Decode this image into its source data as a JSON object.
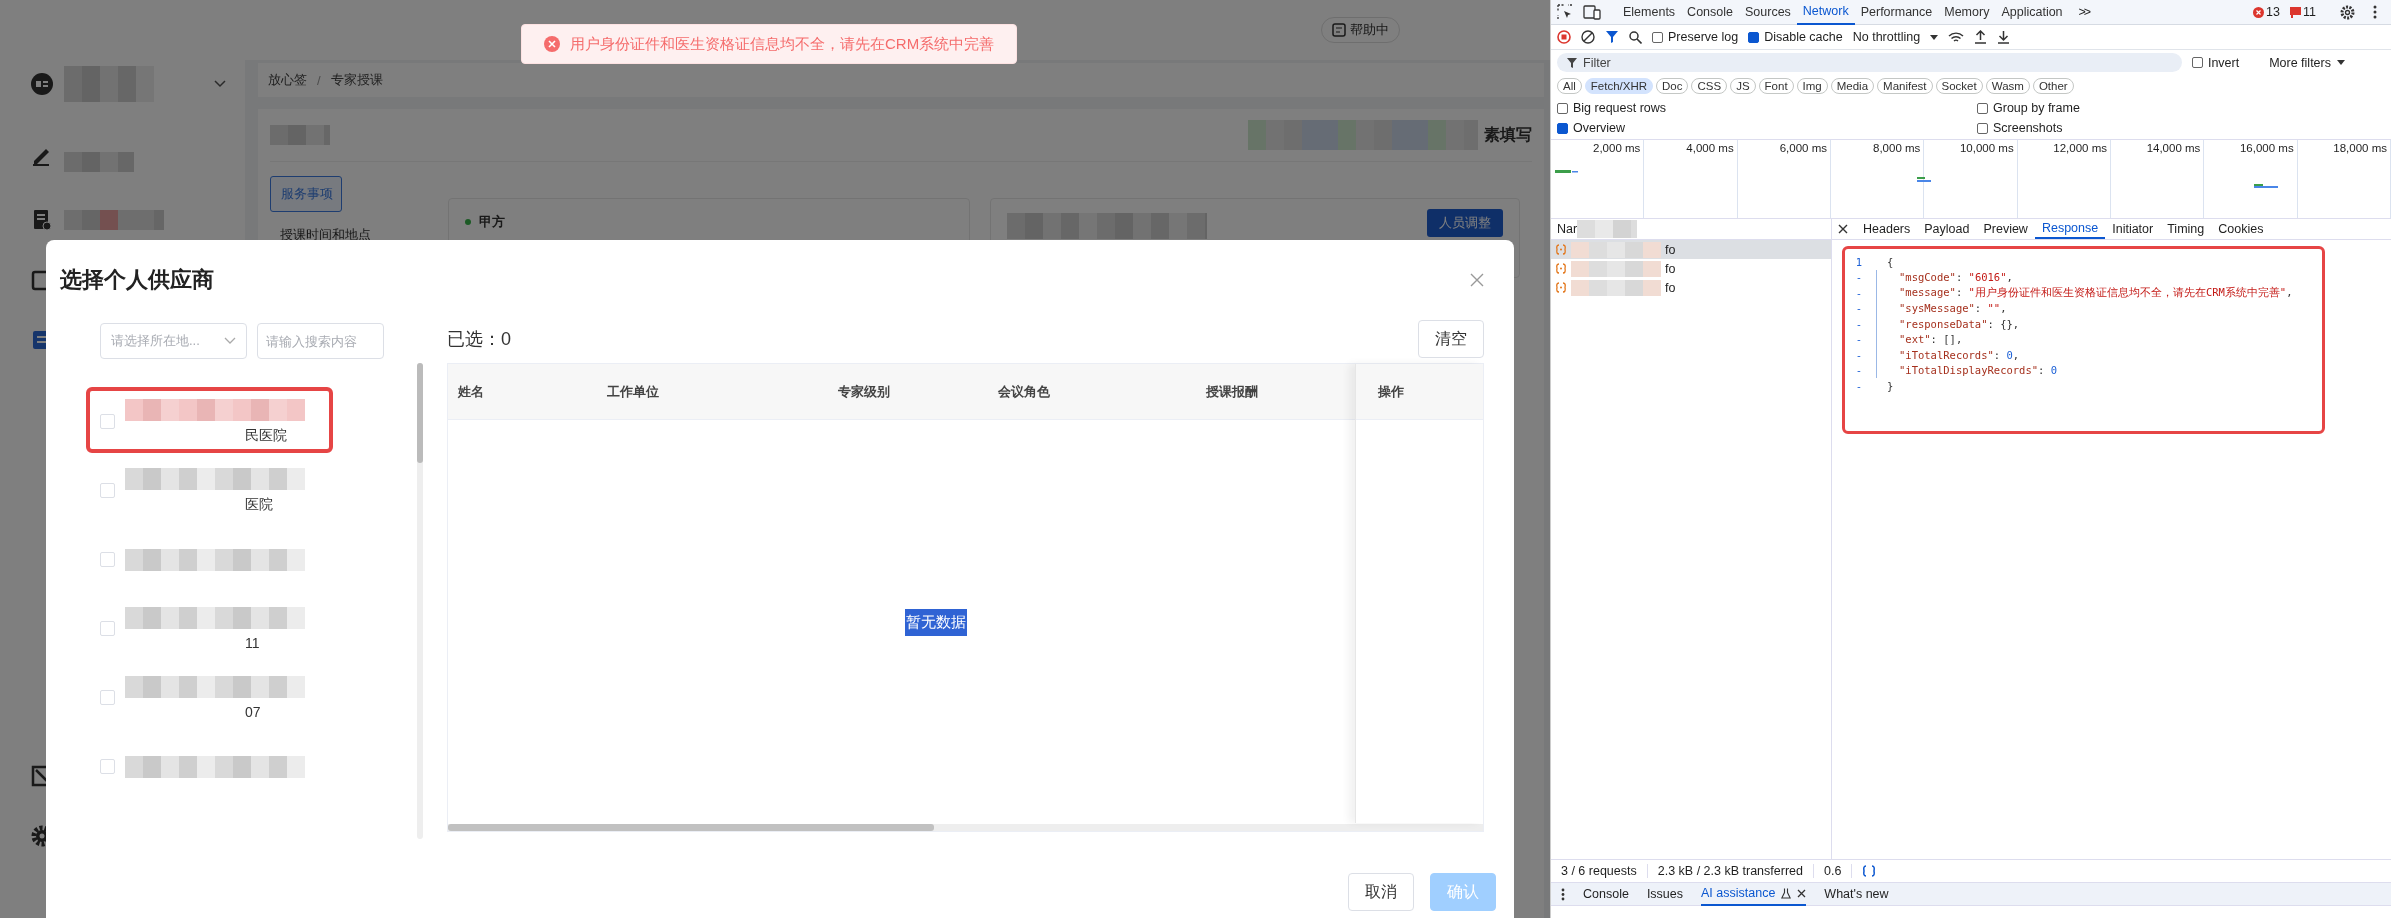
{
  "app": {
    "help_button": "帮助中",
    "breadcrumb": [
      {
        "label": "放心签"
      },
      {
        "label": "专家授课"
      }
    ],
    "breadcrumb_separator": "/",
    "section_title": "素填写",
    "service_tab": "服务事项",
    "side_item": "授课时间和地点",
    "party_a": "甲方",
    "adjust_button": "人员调整"
  },
  "toast": {
    "kind": "error",
    "message": "用户身份证件和医生资格证信息均不全，请先在CRM系统中完善"
  },
  "modal": {
    "title": "选择个人供应商",
    "region_select": {
      "placeholder": "请选择所在地..."
    },
    "search": {
      "placeholder": "请输入搜索内容"
    },
    "suppliers": [
      {
        "checked": false,
        "annotated": true,
        "text": "民医院"
      },
      {
        "checked": false,
        "annotated": false,
        "text": "医院"
      },
      {
        "checked": false,
        "annotated": false
      },
      {
        "checked": false,
        "annotated": false,
        "text": "11"
      },
      {
        "checked": false,
        "annotated": false,
        "text": "07"
      },
      {
        "checked": false,
        "annotated": false
      }
    ],
    "selected_count": "已选：0",
    "clear_button": "清空",
    "table": {
      "columns": [
        "姓名",
        "工作单位",
        "专家级别",
        "会议角色",
        "授课报酬",
        "操作"
      ],
      "empty_text": "暂无数据"
    },
    "buttons": [
      {
        "label": "取消",
        "disabled": false
      },
      {
        "label": "确认",
        "disabled": true
      }
    ]
  },
  "devtools": {
    "panel_tabs": [
      {
        "label": "Elements",
        "selected": false
      },
      {
        "label": "Console",
        "selected": false
      },
      {
        "label": "Sources",
        "selected": false
      },
      {
        "label": "Network",
        "selected": true
      },
      {
        "label": "Performance",
        "selected": false
      },
      {
        "label": "Memory",
        "selected": false
      },
      {
        "label": "Application",
        "selected": false
      }
    ],
    "more_tabs": ">>",
    "error_count": "13",
    "issue_count": "11",
    "preserve_log": {
      "label": "Preserve log",
      "checked": false
    },
    "disable_cache": {
      "label": "Disable cache",
      "checked": true
    },
    "throttling": "No throttling",
    "filter": {
      "placeholder": "Filter"
    },
    "invert": {
      "label": "Invert",
      "checked": false
    },
    "more_filters": "More filters",
    "type_filters": [
      {
        "label": "All",
        "selected": false
      },
      {
        "label": "Fetch/XHR",
        "selected": true
      },
      {
        "label": "Doc",
        "selected": false
      },
      {
        "label": "CSS",
        "selected": false
      },
      {
        "label": "JS",
        "selected": false
      },
      {
        "label": "Font",
        "selected": false
      },
      {
        "label": "Img",
        "selected": false
      },
      {
        "label": "Media",
        "selected": false
      },
      {
        "label": "Manifest",
        "selected": false
      },
      {
        "label": "Socket",
        "selected": false
      },
      {
        "label": "Wasm",
        "selected": false
      },
      {
        "label": "Other",
        "selected": false
      }
    ],
    "options": [
      {
        "label": "Big request rows",
        "checked": false
      },
      {
        "label": "Group by frame",
        "checked": false
      },
      {
        "label": "Overview",
        "checked": true
      },
      {
        "label": "Screenshots",
        "checked": false
      }
    ],
    "timeline_ticks": [
      "2,000 ms",
      "4,000 ms",
      "6,000 ms",
      "8,000 ms",
      "10,000 ms",
      "12,000 ms",
      "14,000 ms",
      "16,000 ms",
      "18,000 ms"
    ],
    "name_header": "Nar",
    "requests": [
      {
        "name": "fo",
        "selected": true
      },
      {
        "name": "fo",
        "selected": false
      },
      {
        "name": "fo",
        "selected": false
      }
    ],
    "detail_tabs": [
      {
        "label": "Headers",
        "selected": false
      },
      {
        "label": "Payload",
        "selected": false
      },
      {
        "label": "Preview",
        "selected": false
      },
      {
        "label": "Response",
        "selected": true
      },
      {
        "label": "Initiator",
        "selected": false
      },
      {
        "label": "Timing",
        "selected": false
      },
      {
        "label": "Cookies",
        "selected": false
      }
    ],
    "response": {
      "annotated": true,
      "lines": [
        {
          "marker": "1",
          "tokens": [
            {
              "kind": "punct",
              "text": "{"
            }
          ]
        },
        {
          "marker": "-",
          "tokens": [
            {
              "kind": "key",
              "text": "\"msgCode\""
            },
            {
              "kind": "punct",
              "text": ": "
            },
            {
              "kind": "string",
              "text": "\"6016\""
            },
            {
              "kind": "punct",
              "text": ","
            }
          ]
        },
        {
          "marker": "-",
          "tokens": [
            {
              "kind": "key",
              "text": "\"message\""
            },
            {
              "kind": "punct",
              "text": ": "
            },
            {
              "kind": "string",
              "text": "\"用户身份证件和医生资格证信息均不全，请先在CRM系统中完善\""
            },
            {
              "kind": "punct",
              "text": ","
            }
          ]
        },
        {
          "marker": "-",
          "tokens": [
            {
              "kind": "key",
              "text": "\"sysMessage\""
            },
            {
              "kind": "punct",
              "text": ": "
            },
            {
              "kind": "string",
              "text": "\"\""
            },
            {
              "kind": "punct",
              "text": ","
            }
          ]
        },
        {
          "marker": "-",
          "tokens": [
            {
              "kind": "key",
              "text": "\"responseData\""
            },
            {
              "kind": "punct",
              "text": ": {},"
            }
          ]
        },
        {
          "marker": "-",
          "tokens": [
            {
              "kind": "key",
              "text": "\"ext\""
            },
            {
              "kind": "punct",
              "text": ": [],"
            }
          ]
        },
        {
          "marker": "-",
          "tokens": [
            {
              "kind": "key",
              "text": "\"iTotalRecords\""
            },
            {
              "kind": "punct",
              "text": ": "
            },
            {
              "kind": "number",
              "text": "0"
            },
            {
              "kind": "punct",
              "text": ","
            }
          ]
        },
        {
          "marker": "-",
          "tokens": [
            {
              "kind": "key",
              "text": "\"iTotalDisplayRecords\""
            },
            {
              "kind": "punct",
              "text": ": "
            },
            {
              "kind": "number",
              "text": "0"
            }
          ]
        },
        {
          "marker": "-",
          "tokens": [
            {
              "kind": "punct",
              "text": "}"
            }
          ]
        }
      ]
    },
    "status": [
      "3 / 6 requests",
      "2.3 kB / 2.3 kB transferred",
      "0.6"
    ],
    "drawer_tabs": [
      {
        "label": "Console",
        "selected": false,
        "closable": false
      },
      {
        "label": "Issues",
        "selected": false,
        "closable": false
      },
      {
        "label": "AI assistance",
        "selected": true,
        "closable": true
      },
      {
        "label": "What's new",
        "selected": false,
        "closable": false
      }
    ]
  }
}
